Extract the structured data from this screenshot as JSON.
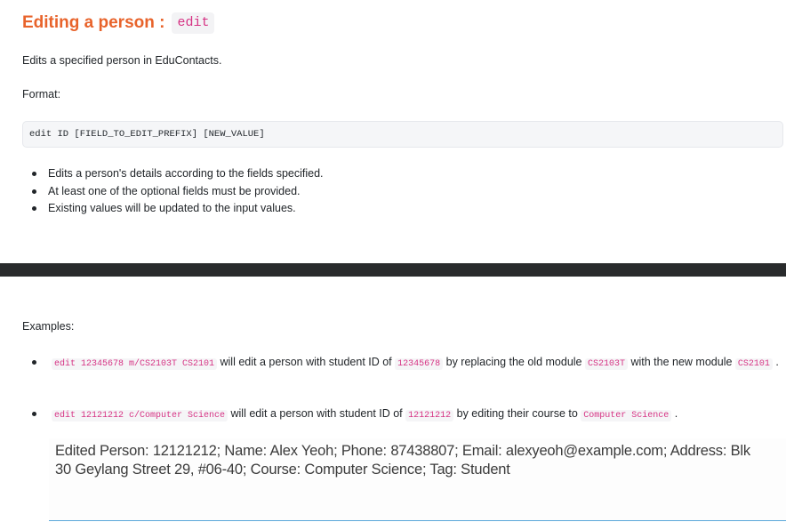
{
  "section": {
    "title": "Editing a person :",
    "command": "edit"
  },
  "description": "Edits a specified person in EduContacts.",
  "format_label": "Format:",
  "format_code": "edit ID [FIELD_TO_EDIT_PREFIX] [NEW_VALUE]",
  "bullets": [
    "Edits a person's details according to the fields specified.",
    "At least one of the optional fields must be provided.",
    "Existing values will be updated to the input values."
  ],
  "examples_label": "Examples:",
  "examples": [
    {
      "command": "edit 12345678 m/CS2103T CS2101",
      "text1": " will edit a person with student ID of ",
      "id": "12345678",
      "text2": " by replacing the old module ",
      "old_module": "CS2103T",
      "text3": " with the new module ",
      "new_module": "CS2101",
      "text4": " ."
    },
    {
      "command": "edit 12121212 c/Computer Science",
      "text1": " will edit a person with student ID of ",
      "id": "12121212",
      "text2": " by editing their course to ",
      "course": "Computer Science",
      "text3": " ."
    }
  ],
  "result_output": "Edited Person: 12121212; Name: Alex Yeoh; Phone: 87438807; Email: alexyeoh@example.com; Address: Blk 30 Geylang Street 29, #06-40; Course: Computer Science; Tag: Student"
}
